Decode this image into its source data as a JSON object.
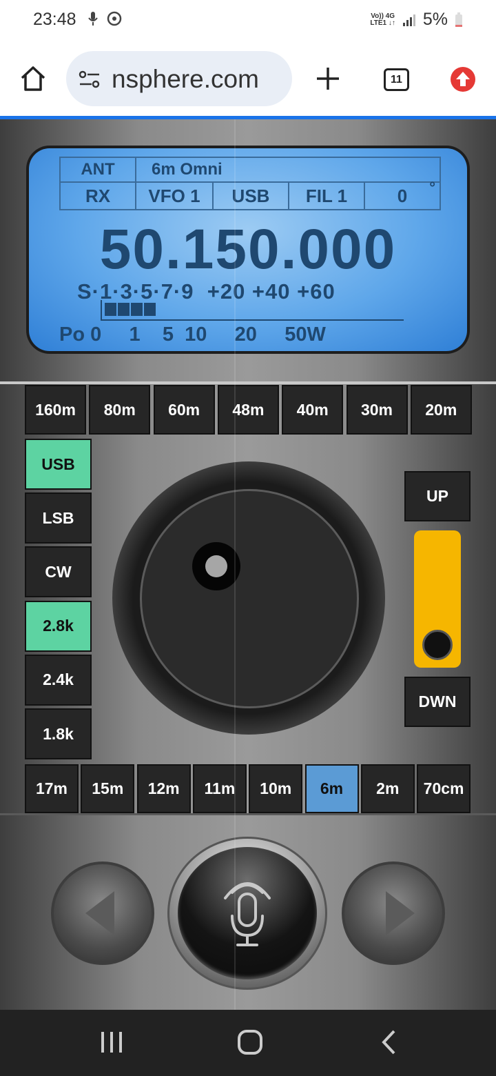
{
  "status_bar": {
    "time": "23:48",
    "network_top": "Vo)) 4G",
    "network_bottom": "LTE1 ↓↑",
    "battery": "5%",
    "battery_color": "#e57373"
  },
  "browser": {
    "url": "nsphere.com",
    "tab_count": "11",
    "update_color": "#e53935",
    "accent": "#1a73e8"
  },
  "lcd": {
    "ant_label": "ANT",
    "ant_value": "6m Omni",
    "rx": "RX",
    "vfo": "VFO 1",
    "mode": "USB",
    "filter": "FIL 1",
    "value": "0",
    "degree": "°",
    "frequency": "50.150.000",
    "s_scale": "S·1·3·5·7·9  +20 +40 +60",
    "s_meter_segments": 4,
    "po_scale": "Po 0     1    5  10     20     50W"
  },
  "bands_top": [
    "160m",
    "80m",
    "60m",
    "48m",
    "40m",
    "30m",
    "20m"
  ],
  "mode_buttons": [
    {
      "label": "USB",
      "active": true
    },
    {
      "label": "LSB",
      "active": false
    },
    {
      "label": "CW",
      "active": false
    },
    {
      "label": "2.8k",
      "active": true
    },
    {
      "label": "2.4k",
      "active": false
    },
    {
      "label": "1.8k",
      "active": false
    }
  ],
  "tune": {
    "up": "UP",
    "down": "DWN",
    "slider_color": "#f6b600"
  },
  "bands_bottom": [
    {
      "label": "17m",
      "active": false
    },
    {
      "label": "15m",
      "active": false
    },
    {
      "label": "12m",
      "active": false
    },
    {
      "label": "11m",
      "active": false
    },
    {
      "label": "10m",
      "active": false
    },
    {
      "label": "6m",
      "active": true
    },
    {
      "label": "2m",
      "active": false
    },
    {
      "label": "70cm",
      "active": false
    }
  ],
  "colors": {
    "active_green": "#5dd3a2",
    "active_blue": "#5b9bd5",
    "lcd_text": "#1f4870"
  },
  "icons": {
    "home": "home-icon",
    "site_settings": "site-settings-icon",
    "new_tab": "plus-icon",
    "update": "update-arrow-icon",
    "mic": "microphone-icon",
    "left": "triangle-left-icon",
    "right": "triangle-right-icon",
    "recents": "recents-icon",
    "home_nav": "home-nav-icon",
    "back": "back-icon"
  }
}
